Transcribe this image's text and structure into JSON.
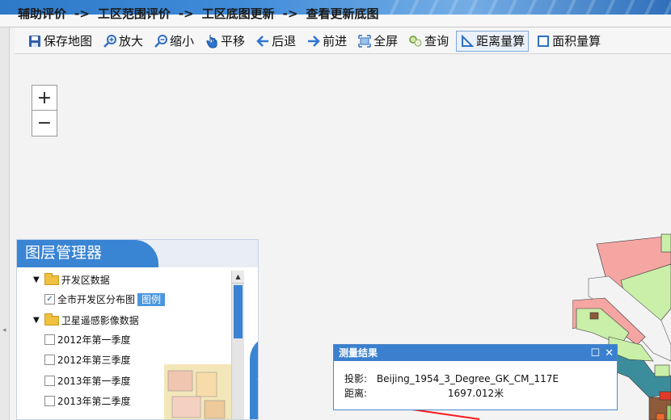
{
  "breadcrumb": [
    "辅助评价",
    "工区范围评价",
    "工区底图更新",
    "查看更新底图"
  ],
  "breadcrumb_separator": "->",
  "toolbar": [
    {
      "id": "save",
      "label": "保存地图",
      "icon": "save-icon"
    },
    {
      "id": "zoom-in",
      "label": "放大",
      "icon": "zoom-in-icon"
    },
    {
      "id": "zoom-out",
      "label": "缩小",
      "icon": "zoom-out-icon"
    },
    {
      "id": "pan",
      "label": "平移",
      "icon": "hand-icon"
    },
    {
      "id": "back",
      "label": "后退",
      "icon": "arrow-left-icon"
    },
    {
      "id": "forward",
      "label": "前进",
      "icon": "arrow-right-icon"
    },
    {
      "id": "fullscreen",
      "label": "全屏",
      "icon": "fullscreen-icon"
    },
    {
      "id": "query",
      "label": "查询",
      "icon": "query-icon"
    },
    {
      "id": "distance",
      "label": "距离量算",
      "icon": "ruler-icon",
      "active": true
    },
    {
      "id": "area",
      "label": "面积量算",
      "icon": "area-icon"
    }
  ],
  "zoom": {
    "plus": "+",
    "minus": "−"
  },
  "layer_panel": {
    "title": "图层管理器",
    "group1": "开发区数据",
    "group1_item": "全市开发区分布图",
    "legend_label": "图例",
    "group2": "卫星遥感影像数据",
    "group2_items": [
      "2012年第一季度",
      "2012年第三季度",
      "2013年第一季度",
      "2013年第二季度"
    ]
  },
  "popup": {
    "title": "测量结果",
    "projection_label": "投影:",
    "projection_value": "Beijing_1954_3_Degree_GK_CM_117E",
    "distance_label": "距离:",
    "distance_value": "1697.012米"
  },
  "colors": {
    "accent": "#3a84d4",
    "panel_header": "#3a80cf"
  }
}
